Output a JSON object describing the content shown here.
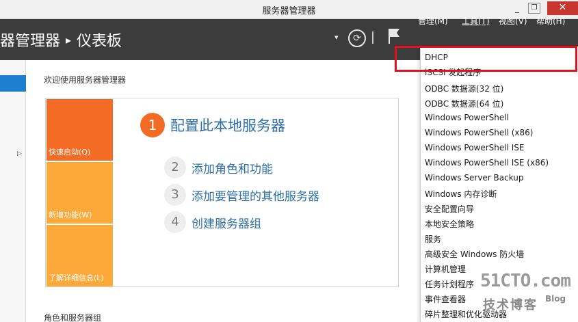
{
  "window": {
    "title": "服务器管理器",
    "minimize": "_",
    "restore": "❐",
    "close": "✕"
  },
  "header": {
    "breadcrumb_root": "器管理器",
    "breadcrumb_sep": "▸",
    "breadcrumb_current": "仪表板",
    "dropdown_arrow": "▾",
    "refresh_glyph": "⟳",
    "menus": {
      "manage": "管理(M)",
      "tools": "工具(T)",
      "view": "视图(V)",
      "help": "帮助(H)"
    }
  },
  "leftnav": {
    "expand_glyph": "▷"
  },
  "main": {
    "welcome": "欢迎使用服务器管理器",
    "tiles": {
      "quick_start": "快速启动(Q)",
      "new_features": "新增功能(W)",
      "learn_more": "了解详细信息(L)"
    },
    "steps": [
      {
        "num": "1",
        "label": "配置此本地服务器"
      },
      {
        "num": "2",
        "label": "添加角色和功能"
      },
      {
        "num": "3",
        "label": "添加要管理的其他服务器"
      },
      {
        "num": "4",
        "label": "创建服务器组"
      }
    ],
    "roles_title": "角色和服务器组"
  },
  "tools_menu": {
    "items": [
      "DHCP",
      "iSCSI 发起程序",
      "ODBC 数据源(32 位)",
      "ODBC 数据源(64 位)",
      "Windows PowerShell",
      "Windows PowerShell (x86)",
      "Windows PowerShell ISE",
      "Windows PowerShell ISE (x86)",
      "Windows Server Backup",
      "Windows 内存诊断",
      "安全配置向导",
      "本地安全策略",
      "服务",
      "高级安全 Windows 防火墙",
      "计算机管理",
      "任务计划程序",
      "事件查看器",
      "碎片整理和优化驱动器"
    ],
    "highlighted_color": "#e2111c"
  },
  "watermark": {
    "main": "51CTO.com",
    "sub": "技术博客",
    "blog": "Blog"
  },
  "colors": {
    "header_bg": "#3c3c3c",
    "accent_orange": "#f36b24",
    "tile_amber": "#fca93a",
    "link_blue": "#2e6ea6",
    "nav_selected": "#1e7fd0"
  }
}
